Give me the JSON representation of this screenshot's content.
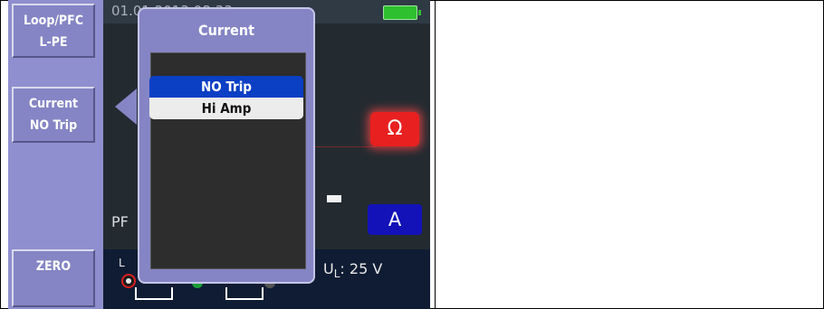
{
  "left_panel": {
    "buttons": [
      {
        "line1": "Loop/PFC",
        "line2": "L-PE"
      },
      {
        "line1": "Current",
        "line2": "NO Trip"
      },
      {
        "line1": "ZERO"
      }
    ]
  },
  "status": {
    "date_time": "01.01.2013   08:33",
    "battery_icon": "battery-full-icon"
  },
  "display": {
    "pf_label": "PF",
    "ul_prefix": "U",
    "ul_sub": "L",
    "ul_value": ": 25 V",
    "l_label": "L"
  },
  "function_buttons": {
    "ohm": "Ω",
    "amp": "A"
  },
  "popup": {
    "title": "Current",
    "options": [
      "NO Trip",
      "Hi Amp"
    ],
    "selected": "NO Trip"
  },
  "colors": {
    "panel": "#8585c5",
    "selected": "#0b3fc4",
    "ohm": "#e82020",
    "amp": "#1212b8"
  }
}
